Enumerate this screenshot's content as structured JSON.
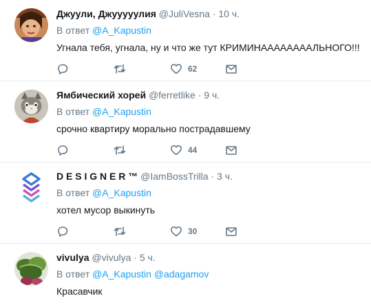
{
  "tweets": [
    {
      "name": "Джуули, Джууууулия",
      "handle": "@JuliVesna",
      "sep": " · ",
      "time": "10 ч.",
      "reply_prefix": "В ответ",
      "reply_mentions": [
        "@A_Kapustin"
      ],
      "text": "Угнала тебя, угнала, ну и что же тут КРИМИНААААААААЛЬНОГО!!!",
      "likes": "62"
    },
    {
      "name": "Ямбический хорей",
      "handle": "@ferretlike",
      "sep": " · ",
      "time": "9 ч.",
      "reply_prefix": "В ответ",
      "reply_mentions": [
        "@A_Kapustin"
      ],
      "text": "срочно квартиру морально пострадавшему",
      "likes": "44"
    },
    {
      "name": "D E S I G N E R ™",
      "handle": "@IamBossTrilla",
      "sep": " · ",
      "time": "3 ч.",
      "reply_prefix": "В ответ",
      "reply_mentions": [
        "@A_Kapustin"
      ],
      "text": "хотел мусор выкинуть",
      "likes": "30"
    },
    {
      "name": "vivulya",
      "handle": "@vivulya",
      "sep": " · ",
      "time": "5 ч.",
      "reply_prefix": "В ответ",
      "reply_mentions": [
        "@A_Kapustin",
        "@adagamov"
      ],
      "text": "Красавчик",
      "likes": ""
    }
  ],
  "icons": {
    "reply": "reply-icon",
    "retweet": "retweet-icon",
    "like": "heart-icon",
    "dm": "envelope-icon"
  },
  "colors": {
    "mention": "#1da1f2",
    "secondary": "#657786",
    "divider": "#e6ecf0"
  }
}
